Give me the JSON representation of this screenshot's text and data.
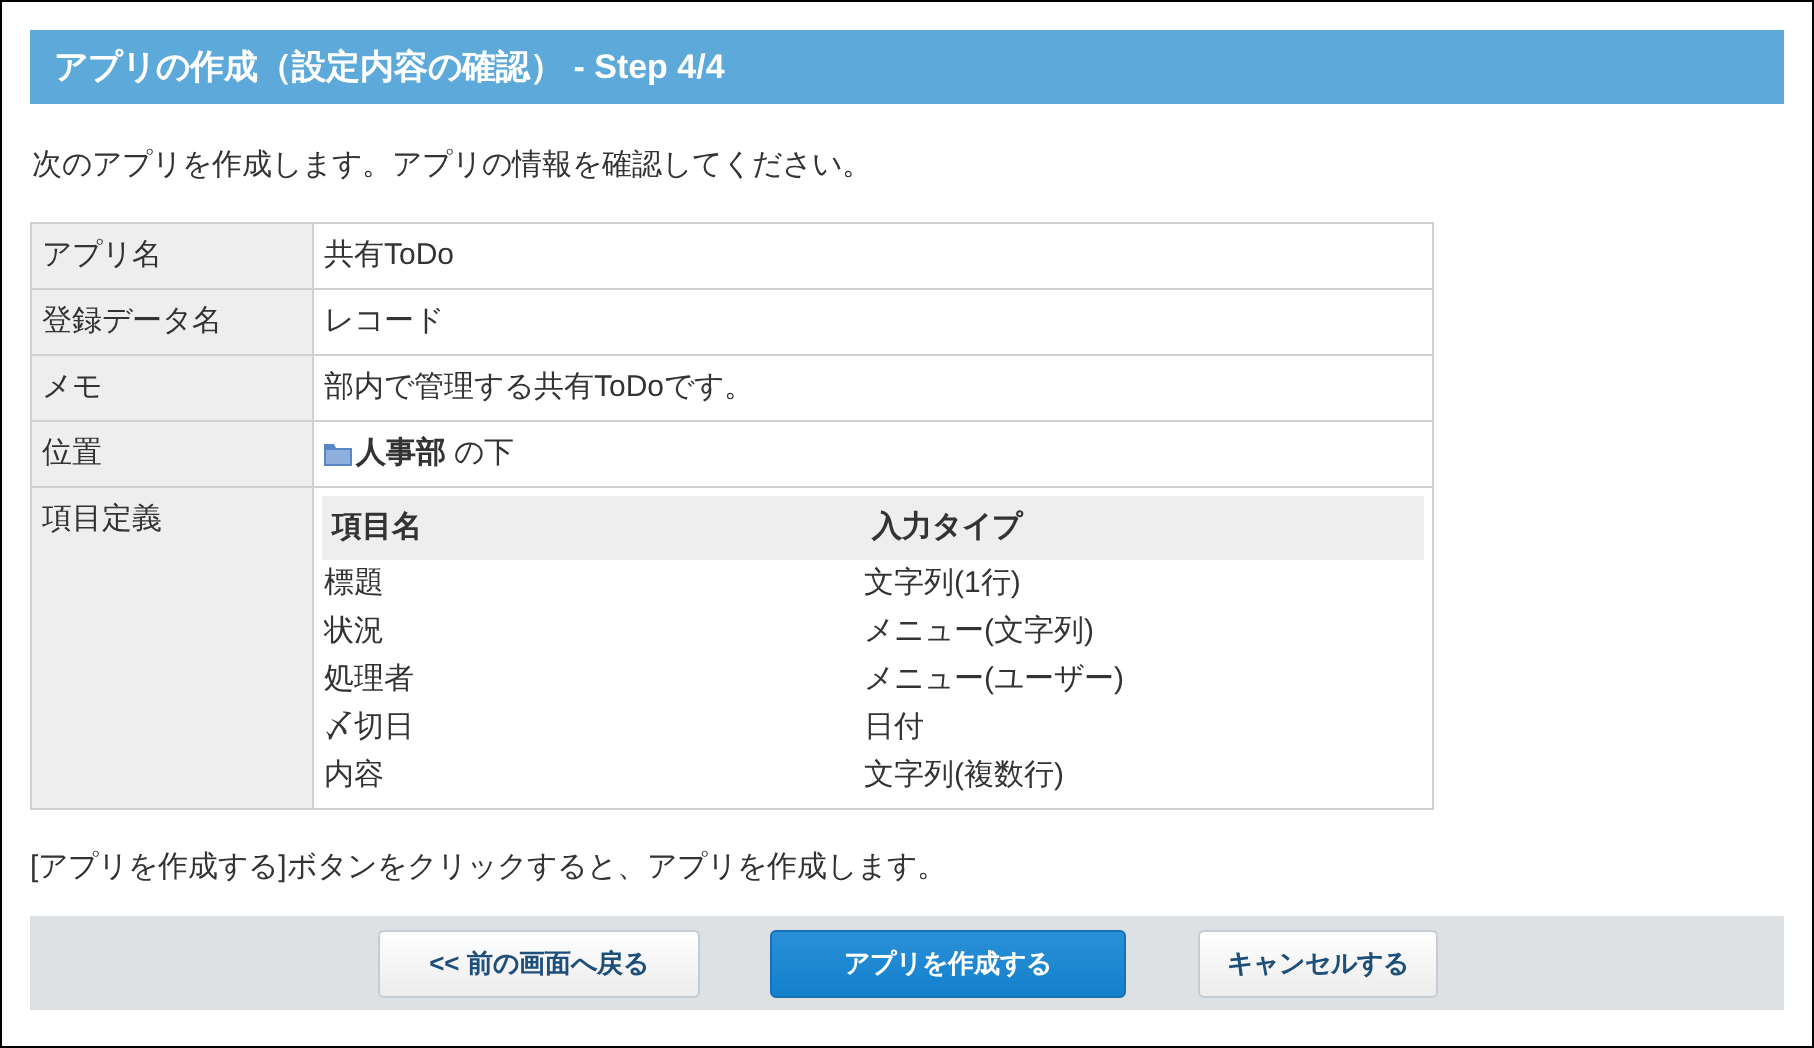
{
  "header": {
    "title": "アプリの作成（設定内容の確認） - Step 4/4"
  },
  "intro": "次のアプリを作成します。アプリの情報を確認してください。",
  "details": [
    {
      "kind": "text",
      "label": "アプリ名",
      "value": "共有ToDo"
    },
    {
      "kind": "text",
      "label": "登録データ名",
      "value": "レコード"
    },
    {
      "kind": "text",
      "label": "メモ",
      "value": "部内で管理する共有ToDoです。"
    },
    {
      "kind": "folder",
      "label": "位置",
      "value": "**人事部** の下"
    },
    {
      "kind": "fields",
      "label": "項目定義",
      "columns": [
        "項目名",
        "入力タイプ"
      ],
      "rows": [
        [
          "標題",
          "文字列(1行)"
        ],
        [
          "状況",
          "メニュー(文字列)"
        ],
        [
          "処理者",
          "メニュー(ユーザー)"
        ],
        [
          "〆切日",
          "日付"
        ],
        [
          "内容",
          "文字列(複数行)"
        ]
      ]
    }
  ],
  "note": "[アプリを作成する]ボタンをクリックすると、アプリを作成します。",
  "buttons": [
    {
      "label": "<< 前の画面へ戻る",
      "kind": "secondary"
    },
    {
      "label": "アプリを作成する",
      "kind": "primary"
    },
    {
      "label": "キャンセルする",
      "kind": "secondary"
    }
  ]
}
